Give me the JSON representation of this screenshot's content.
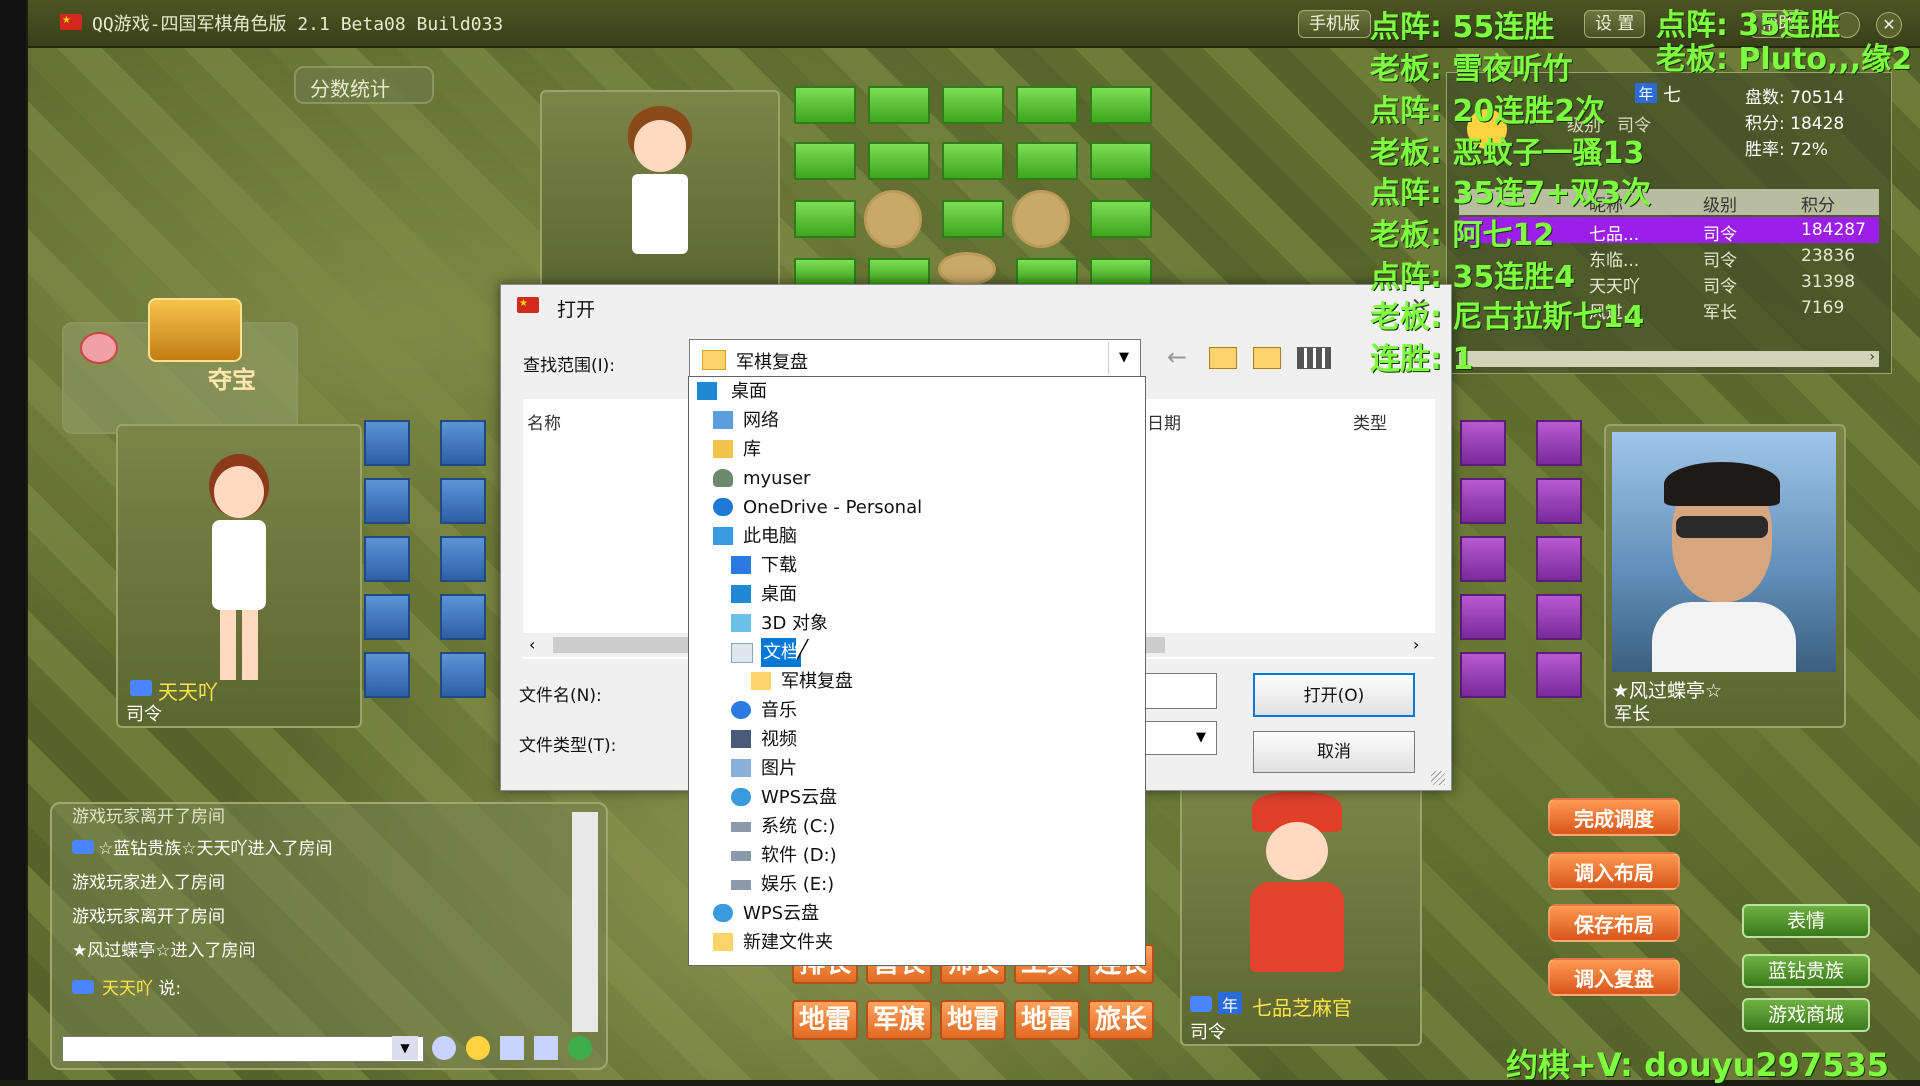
{
  "window": {
    "title": "QQ游戏-四国军棋角色版 2.1 Beta08 Build033",
    "buttons": {
      "phone": "手机版",
      "settings": "设 置",
      "help": "帮助"
    }
  },
  "left_panel": {
    "score_stats": "分数统计",
    "treasure": "夺宝",
    "player_left": {
      "name": "天天吖",
      "rank": "司令"
    }
  },
  "chat": {
    "lines": [
      "游戏玩家离开了房间",
      "☆蓝钻贵族☆天天吖进入了房间",
      "游戏玩家进入了房间",
      "游戏玩家离开了房间",
      "★风过蝶亭☆进入了房间"
    ],
    "last_speaker": "天天吖",
    "says": "说:",
    "input_placeholder": ""
  },
  "bottom_pieces": [
    "排长",
    "营长",
    "师长",
    "工兵",
    "连长",
    "地雷",
    "军旗",
    "地雷",
    "地雷",
    "旅长"
  ],
  "player_bottom": {
    "name": "七品芝麻官",
    "rank": "司令",
    "badge": "年"
  },
  "player_right": {
    "name": "★风过蝶亭☆",
    "rank": "军长"
  },
  "stats_panel": {
    "title_name": "七",
    "badge": "年",
    "rank_label": "级别",
    "rank_value": "司令",
    "games": "盘数: 70514",
    "score": "积分: 18428",
    "winrate": "胜率: 72%",
    "table_headers": [
      "昵称",
      "级别",
      "积分"
    ],
    "rows": [
      {
        "name": "七品...",
        "rank": "司令",
        "score": "184287"
      },
      {
        "name": "东临...",
        "rank": "司令",
        "score": "23836"
      },
      {
        "name": "天天吖",
        "rank": "司令",
        "score": "31398"
      },
      {
        "name": "风过...",
        "rank": "军长",
        "score": "7169"
      }
    ]
  },
  "right_buttons": {
    "finish": "完成调度",
    "load_layout": "调入布局",
    "save_layout": "保存布局",
    "load_replay": "调入复盘",
    "emotes": "表情",
    "blue_diamond": "蓝钻贵族",
    "shop": "游戏商城"
  },
  "dialog": {
    "title": "打开",
    "look_in_label": "查找范围(I):",
    "look_in_value": "军棋复盘",
    "col_name": "名称",
    "col_date": "日期",
    "col_type": "类型",
    "filename_label": "文件名(N):",
    "filetype_label": "文件类型(T):",
    "open_button": "打开(O)",
    "cancel_button": "取消",
    "dropdown_items": [
      {
        "label": "桌面",
        "icon": "desktop-icon"
      },
      {
        "label": "网络",
        "icon": "network-icon"
      },
      {
        "label": "库",
        "icon": "library-icon"
      },
      {
        "label": "myuser",
        "icon": "user-icon"
      },
      {
        "label": "OneDrive - Personal",
        "icon": "cloud-icon"
      },
      {
        "label": "此电脑",
        "icon": "computer-icon"
      },
      {
        "label": "下载",
        "icon": "download-icon"
      },
      {
        "label": "桌面",
        "icon": "desktop-icon"
      },
      {
        "label": "3D 对象",
        "icon": "cube-icon"
      },
      {
        "label": "文档",
        "icon": "document-icon"
      },
      {
        "label": "军棋复盘",
        "icon": "folder-icon"
      },
      {
        "label": "音乐",
        "icon": "music-icon"
      },
      {
        "label": "视频",
        "icon": "video-icon"
      },
      {
        "label": "图片",
        "icon": "picture-icon"
      },
      {
        "label": "WPS云盘",
        "icon": "cloud-icon"
      },
      {
        "label": "系统 (C:)",
        "icon": "drive-icon"
      },
      {
        "label": "软件 (D:)",
        "icon": "drive-icon"
      },
      {
        "label": "娱乐 (E:)",
        "icon": "drive-icon"
      },
      {
        "label": "WPS云盘",
        "icon": "cloud-icon"
      },
      {
        "label": "新建文件夹",
        "icon": "folder-icon"
      }
    ]
  },
  "stream_overlay": {
    "left_lines": [
      "点阵: 55连胜",
      "老板: 雪夜听竹",
      "点阵: 20连胜2次",
      "老板: 恶蚊子一骚13",
      "点阵: 35连7+双3次",
      "老板: 阿七12",
      "点阵: 35连胜4",
      "老板: 尼古拉斯七14",
      "连胜: 1"
    ],
    "right_lines": [
      "点阵: 35连胜",
      "老板: Pluto,,,缘2"
    ],
    "footer": "约棋+V: douyu297535"
  },
  "colors": {
    "overlay_text": "#7eff3f",
    "selected_row": "#9b1fe8",
    "highlight": "#0078d7"
  }
}
